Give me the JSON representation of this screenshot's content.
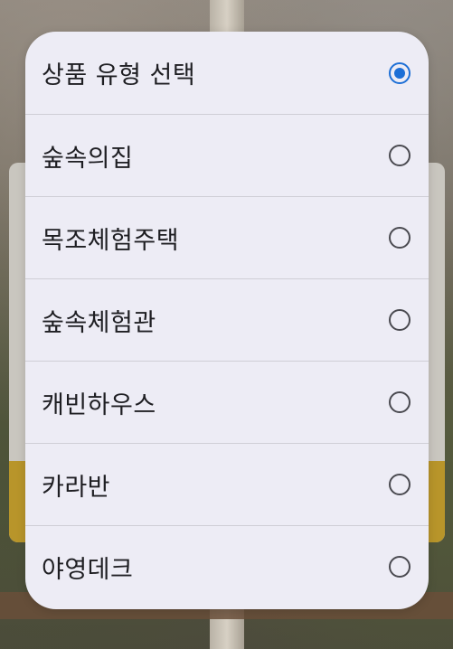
{
  "dialog": {
    "options": [
      {
        "label": "상품 유형 선택",
        "selected": true
      },
      {
        "label": "숲속의집",
        "selected": false
      },
      {
        "label": "목조체험주택",
        "selected": false
      },
      {
        "label": "숲속체험관",
        "selected": false
      },
      {
        "label": "캐빈하우스",
        "selected": false
      },
      {
        "label": "카라반",
        "selected": false
      },
      {
        "label": "야영데크",
        "selected": false
      }
    ]
  },
  "colors": {
    "accent": "#1d6fd6",
    "dialog_background": "#edecf5",
    "divider": "#cfced6"
  },
  "icons": {
    "selected": "radio-selected-icon",
    "unselected": "radio-unselected-icon"
  }
}
